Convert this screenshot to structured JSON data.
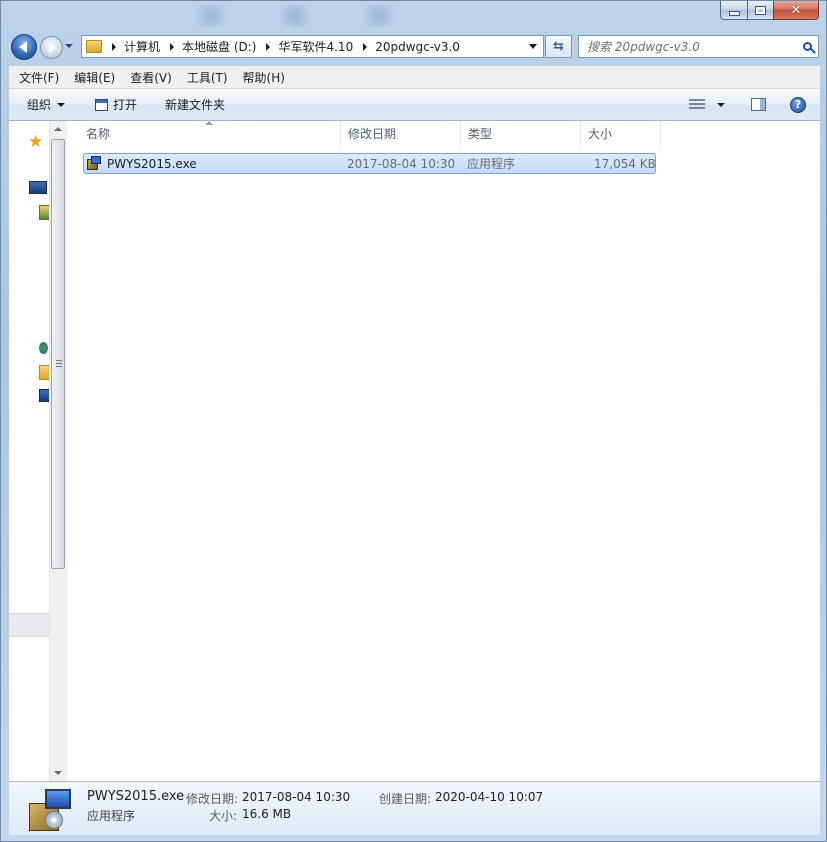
{
  "window": {
    "caption": {
      "minimize": "",
      "maximize": "",
      "close": "✕"
    }
  },
  "address": {
    "crumbs": [
      "计算机",
      "本地磁盘 (D:)",
      "华军软件4.10",
      "20pdwgc-v3.0"
    ]
  },
  "search": {
    "placeholder": "搜索 20pdwgc-v3.0"
  },
  "menu": {
    "items": [
      "文件(F)",
      "编辑(E)",
      "查看(V)",
      "工具(T)",
      "帮助(H)"
    ]
  },
  "toolbar": {
    "organize": "组织",
    "open": "打开",
    "new_folder": "新建文件夹",
    "help_glyph": "?"
  },
  "filelist": {
    "columns": [
      "名称",
      "修改日期",
      "类型",
      "大小"
    ],
    "rows": [
      {
        "name": "PWYS2015.exe",
        "modified": "2017-08-04 10:30",
        "type": "应用程序",
        "size": "17,054 KB"
      }
    ]
  },
  "details": {
    "filename": "PWYS2015.exe",
    "kind": "应用程序",
    "modified_label": "修改日期:",
    "modified_value": "2017-08-04 10:30",
    "created_label": "创建日期:",
    "created_value": "2020-04-10 10:07",
    "size_label": "大小:",
    "size_value": "16.6 MB"
  }
}
